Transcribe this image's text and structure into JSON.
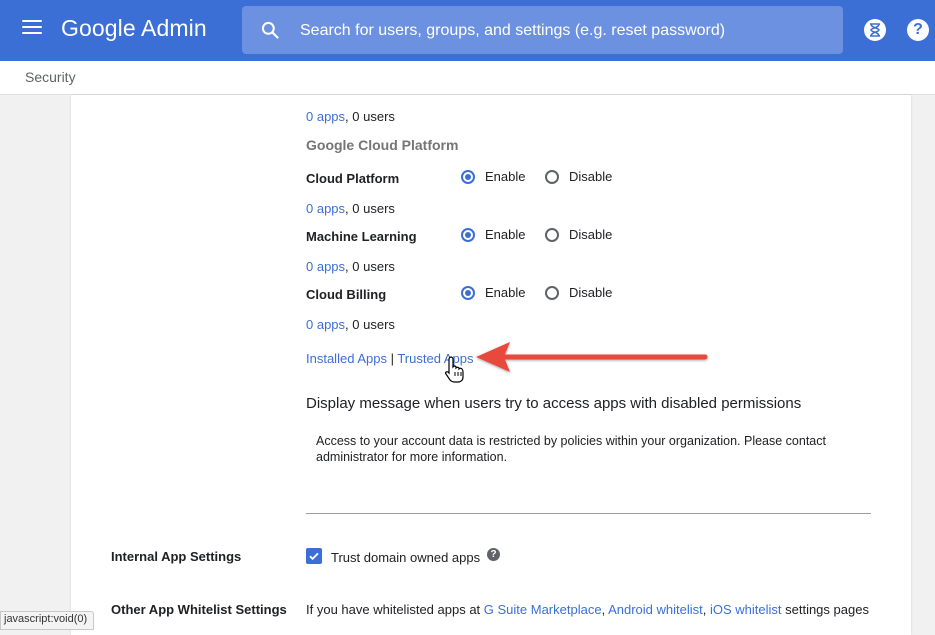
{
  "header": {
    "brand_google": "Google",
    "brand_admin": "Admin",
    "search_placeholder": "Search for users, groups, and settings (e.g. reset password)",
    "menu_icon": "hamburger-menu-icon",
    "timer_icon": "hourglass-icon",
    "help_icon": "help-icon"
  },
  "breadcrumb": "Security",
  "accent_color": "#3b6fd6",
  "content": {
    "top_count": {
      "apps": "0 apps",
      "users": ", 0 users"
    },
    "group_title": "Google Cloud Platform",
    "services": [
      {
        "label": "Cloud Platform",
        "enable": "Enable",
        "disable": "Disable",
        "selected": "Enable",
        "apps": "0 apps",
        "users": ", 0 users"
      },
      {
        "label": "Machine Learning",
        "enable": "Enable",
        "disable": "Disable",
        "selected": "Enable",
        "apps": "0 apps",
        "users": ", 0 users"
      },
      {
        "label": "Cloud Billing",
        "enable": "Enable",
        "disable": "Disable",
        "selected": "Enable",
        "apps": "0 apps",
        "users": ", 0 users"
      }
    ],
    "links": {
      "installed": "Installed Apps",
      "separator": " | ",
      "trusted": "Trusted Apps"
    },
    "message_label": "Display message when users try to access apps with disabled permissions",
    "message_text": "Access to your account data is restricted by policies within your organization. Please contact administrator for more information.",
    "internal": {
      "label": "Internal App Settings",
      "checkbox_label": "Trust domain owned apps",
      "checked": true
    },
    "whitelist": {
      "label": "Other App Whitelist Settings",
      "text_prefix": "If you have whitelisted apps at ",
      "link1": "G Suite Marketplace",
      "sep1": ", ",
      "link2": "Android whitelist",
      "sep2": ", ",
      "link3": "iOS whitelist",
      "text_suffix": " settings pages"
    }
  },
  "status_bar": "javascript:void(0)"
}
